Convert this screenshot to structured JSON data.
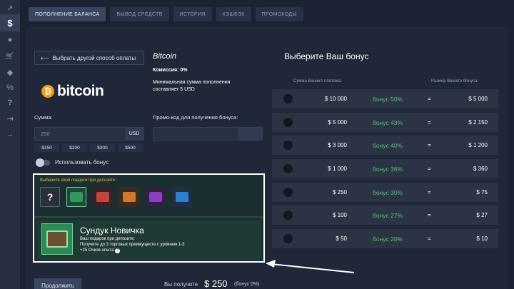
{
  "sidebar": {
    "icons": [
      "chart-icon",
      "dollar-icon",
      "user-icon",
      "cart-icon",
      "diamond-icon",
      "promo-icon",
      "help-icon",
      "logout-icon",
      "arrow-right-icon"
    ],
    "glyphs": [
      "↗",
      "$",
      "●",
      "🛒",
      "◆",
      "%",
      "?",
      "⇥",
      "→"
    ]
  },
  "tabs": [
    {
      "label": "ПОПОЛНЕНИЕ БАЛАНСА"
    },
    {
      "label": "ВЫВОД СРЕДСТВ"
    },
    {
      "label": "ИСТОРИЯ"
    },
    {
      "label": "КЭШБЭК"
    },
    {
      "label": "ПРОМОКОДЫ"
    }
  ],
  "payment": {
    "back_label": "Выбрать другой способ оплаты",
    "logo_symbol": "₿",
    "logo_text": "bitcoin",
    "method_title": "Bitcoin",
    "fee_label": "Комиссия:",
    "fee_value": "0%",
    "min_sum_text": "Минимальная сумма пополнения составляет",
    "min_sum_value": "5 USD"
  },
  "amount": {
    "label": "Сумма:",
    "value": "250",
    "currency": "USD",
    "presets": [
      "$150",
      "$200",
      "$300",
      "$500"
    ]
  },
  "promo": {
    "label": "Промо-код для получения бонуса:",
    "value": ""
  },
  "use_bonus": {
    "label": "Использовать бонус",
    "enabled": false
  },
  "gift": {
    "hint": "Выберите свой подарок при депозите:",
    "chest_colors": [
      "#2f9a5e",
      "#c2453a",
      "#d07a2a",
      "#8a3fc4",
      "#2f7fd0"
    ],
    "title": "Сундук Новичка",
    "line1": "Ваш подарок при депозите:",
    "line2": "Получите до 3 торговых преимуществ с уровнем 1-3",
    "line3": "+25 Очков опыта"
  },
  "bonus": {
    "title": "Выберите Ваш бонус",
    "col_payment": "Сумма Вашего платежа:",
    "col_bonus": "Размер Вашего бонуса:",
    "rows": [
      {
        "amount": "$ 10 000",
        "bonus": "бонус 50%",
        "eq": "=",
        "result": "$ 5 000"
      },
      {
        "amount": "$ 5 000",
        "bonus": "бонус 43%",
        "eq": "=",
        "result": "$ 2 150"
      },
      {
        "amount": "$ 3 000",
        "bonus": "бонус 40%",
        "eq": "=",
        "result": "$ 1 200"
      },
      {
        "amount": "$ 1 000",
        "bonus": "бонус 36%",
        "eq": "=",
        "result": "$ 360"
      },
      {
        "amount": "$ 250",
        "bonus": "бонус 30%",
        "eq": "=",
        "result": "$ 75"
      },
      {
        "amount": "$ 100",
        "bonus": "бонус 27%",
        "eq": "=",
        "result": "$ 27"
      },
      {
        "amount": "$ 50",
        "bonus": "бонус 20%",
        "eq": "=",
        "result": "$ 10"
      }
    ]
  },
  "footer": {
    "continue_label": "Продолжить",
    "receive_label": "Вы получите",
    "receive_amount": "$ 250",
    "receive_bonus": "(бонус 0%)"
  }
}
